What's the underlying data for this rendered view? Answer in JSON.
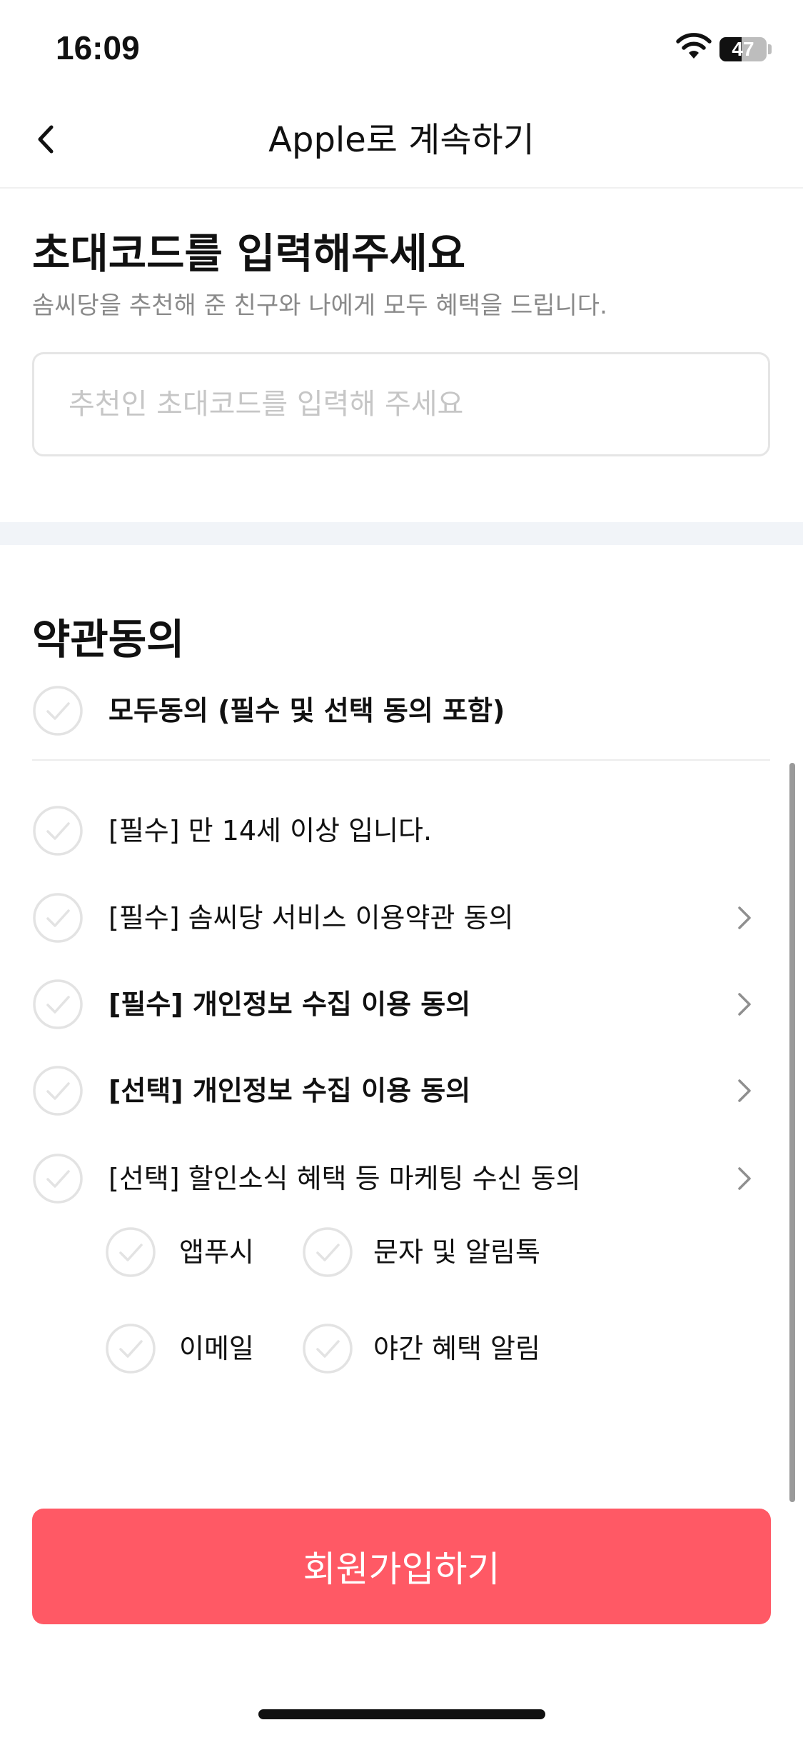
{
  "status_bar": {
    "time": "16:09",
    "battery_percent": 47,
    "battery_label": "47",
    "icons": [
      "wifi-icon",
      "battery-icon"
    ]
  },
  "nav": {
    "title": "Apple로 계속하기",
    "back_icon": "chevron-left-icon"
  },
  "invite": {
    "title": "초대코드를 입력해주세요",
    "subtitle": "솜씨당을 추천해 준 친구와 나에게 모두 혜택을 드립니다.",
    "input_placeholder": "추천인 초대코드를 입력해 주세요",
    "input_value": ""
  },
  "terms": {
    "title": "약관동의",
    "all_agree_label": "모두동의 (필수 및 선택 동의 포함)",
    "items": [
      {
        "label": "[필수] 만 14세 이상 입니다.",
        "bold": false,
        "has_detail": false
      },
      {
        "label": "[필수] 솜씨당 서비스 이용약관 동의",
        "bold": false,
        "has_detail": true
      },
      {
        "label": "[필수] 개인정보 수집 이용 동의",
        "bold": true,
        "has_detail": true
      },
      {
        "label": "[선택] 개인정보 수집 이용 동의",
        "bold": true,
        "has_detail": true
      },
      {
        "label": "[선택] 할인소식 혜택 등 마케팅 수신 동의",
        "bold": false,
        "has_detail": true
      }
    ],
    "marketing_channels": [
      "앱푸시",
      "문자 및 알림톡",
      "이메일",
      "야간 혜택 알림"
    ]
  },
  "footer": {
    "signup_label": "회원가입하기"
  },
  "colors": {
    "accent": "#ff5965",
    "check_gray": "#e3e3e3",
    "divider": "#f1f4f8",
    "subtitle_gray": "#8a8a8a"
  }
}
